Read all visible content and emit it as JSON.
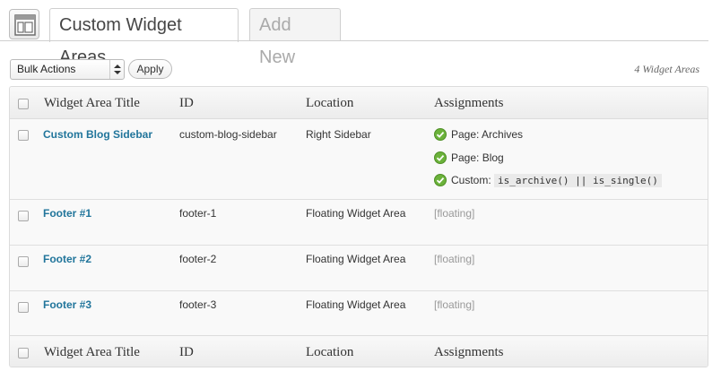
{
  "header": {
    "tabs": [
      {
        "label": "Custom Widget Areas",
        "active": true
      },
      {
        "label": "Add New",
        "active": false
      }
    ]
  },
  "toolbar": {
    "bulk_actions_value": "Bulk Actions",
    "apply_label": "Apply",
    "count_label": "4 Widget Areas"
  },
  "table": {
    "columns": [
      "Widget Area Title",
      "ID",
      "Location",
      "Assignments"
    ],
    "rows": [
      {
        "title": "Custom Blog Sidebar",
        "id": "custom-blog-sidebar",
        "location": "Right Sidebar",
        "assignments": [
          {
            "label": "Page: Archives"
          },
          {
            "label": "Page: Blog"
          },
          {
            "label": "Custom:",
            "code": "is_archive() || is_single()"
          }
        ]
      },
      {
        "title": "Footer #1",
        "id": "footer-1",
        "location": "Floating Widget Area",
        "assignment_text": "[floating]"
      },
      {
        "title": "Footer #2",
        "id": "footer-2",
        "location": "Floating Widget Area",
        "assignment_text": "[floating]"
      },
      {
        "title": "Footer #3",
        "id": "footer-3",
        "location": "Floating Widget Area",
        "assignment_text": "[floating]"
      }
    ]
  },
  "colors": {
    "link": "#21759b",
    "check_green": "#6bb23a",
    "muted": "#999999"
  },
  "icons": {
    "screen_icon": "widgets-layout-icon",
    "check_icon": "green-check-icon"
  }
}
